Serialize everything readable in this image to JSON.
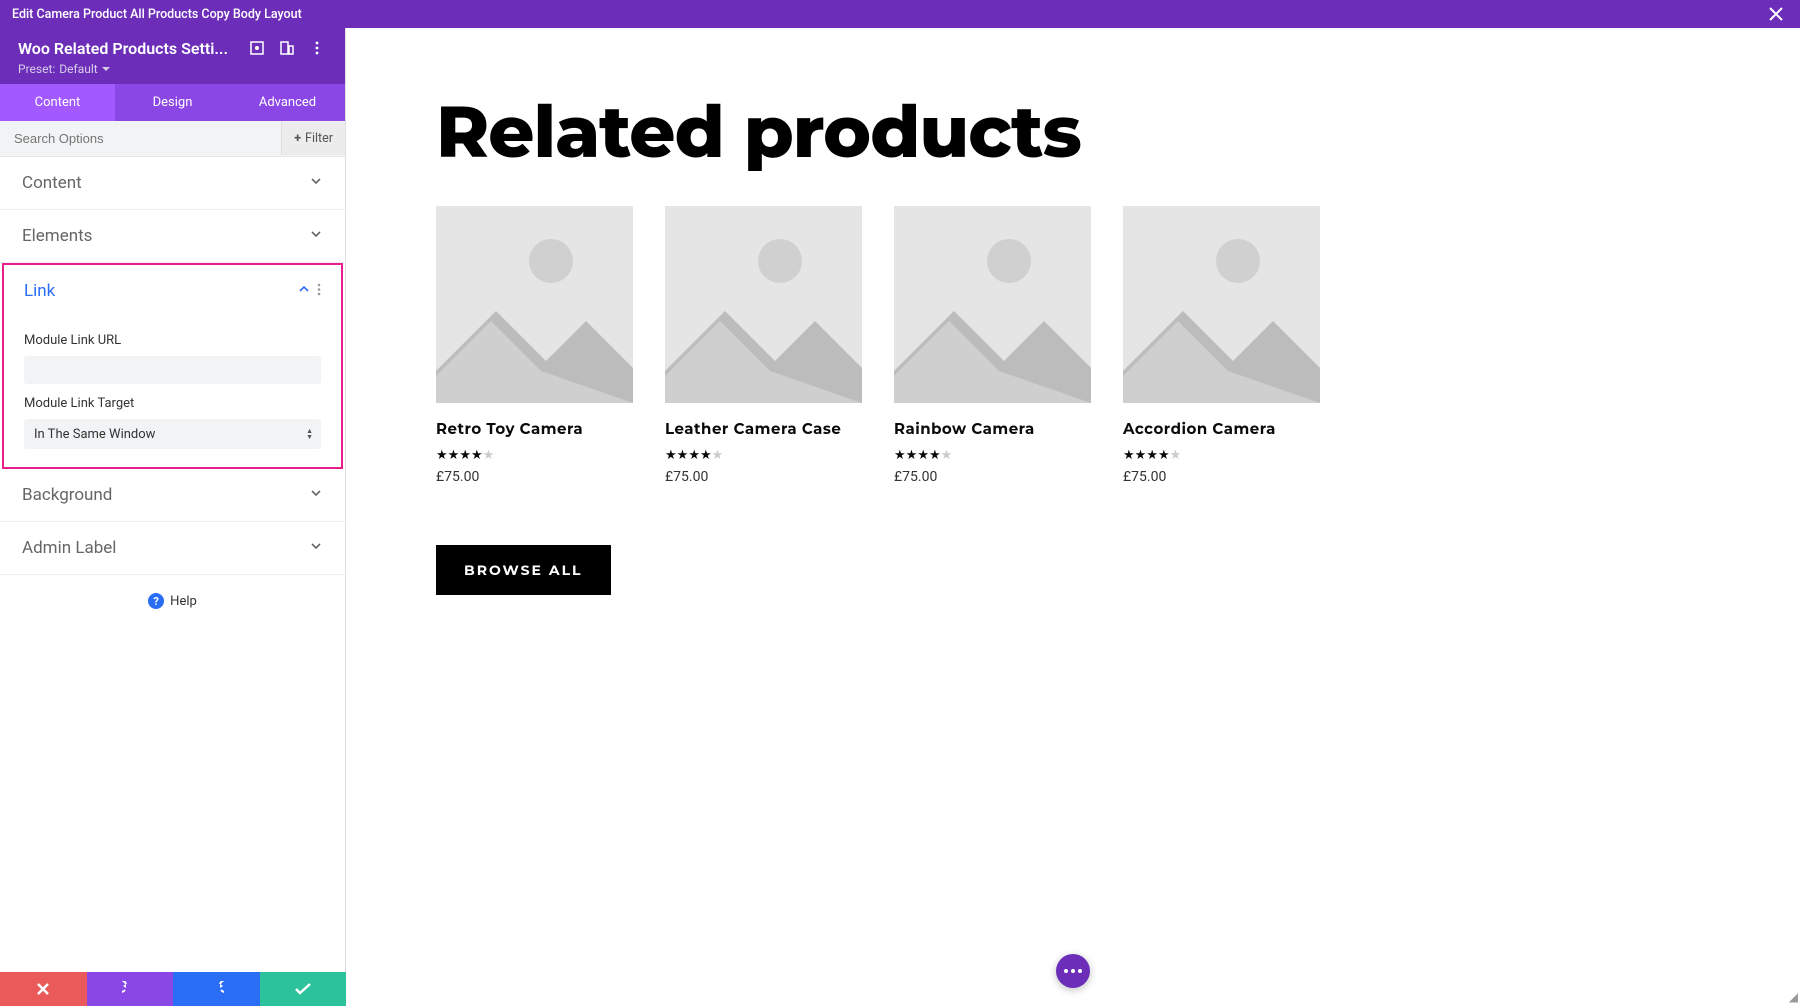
{
  "topbar": {
    "title": "Edit Camera Product All Products Copy Body Layout"
  },
  "sidebar": {
    "module_title": "Woo Related Products Setti...",
    "preset_label": "Preset:",
    "preset_value": "Default",
    "tabs": {
      "content": "Content",
      "design": "Design",
      "advanced": "Advanced"
    },
    "search_placeholder": "Search Options",
    "filter_label": "Filter",
    "sections": {
      "content": "Content",
      "elements": "Elements",
      "link": {
        "title": "Link",
        "url_label": "Module Link URL",
        "url_value": "",
        "target_label": "Module Link Target",
        "target_value": "In The Same Window"
      },
      "background": "Background",
      "admin_label": "Admin Label"
    },
    "help_label": "Help"
  },
  "preview": {
    "heading": "Related products",
    "products": [
      {
        "name": "Retro Toy Camera",
        "price": "£75.00",
        "rating": 4
      },
      {
        "name": "Leather Camera Case",
        "price": "£75.00",
        "rating": 4
      },
      {
        "name": "Rainbow Camera",
        "price": "£75.00",
        "rating": 4
      },
      {
        "name": "Accordion Camera",
        "price": "£75.00",
        "rating": 4
      }
    ],
    "browse_label": "BROWSE ALL"
  }
}
